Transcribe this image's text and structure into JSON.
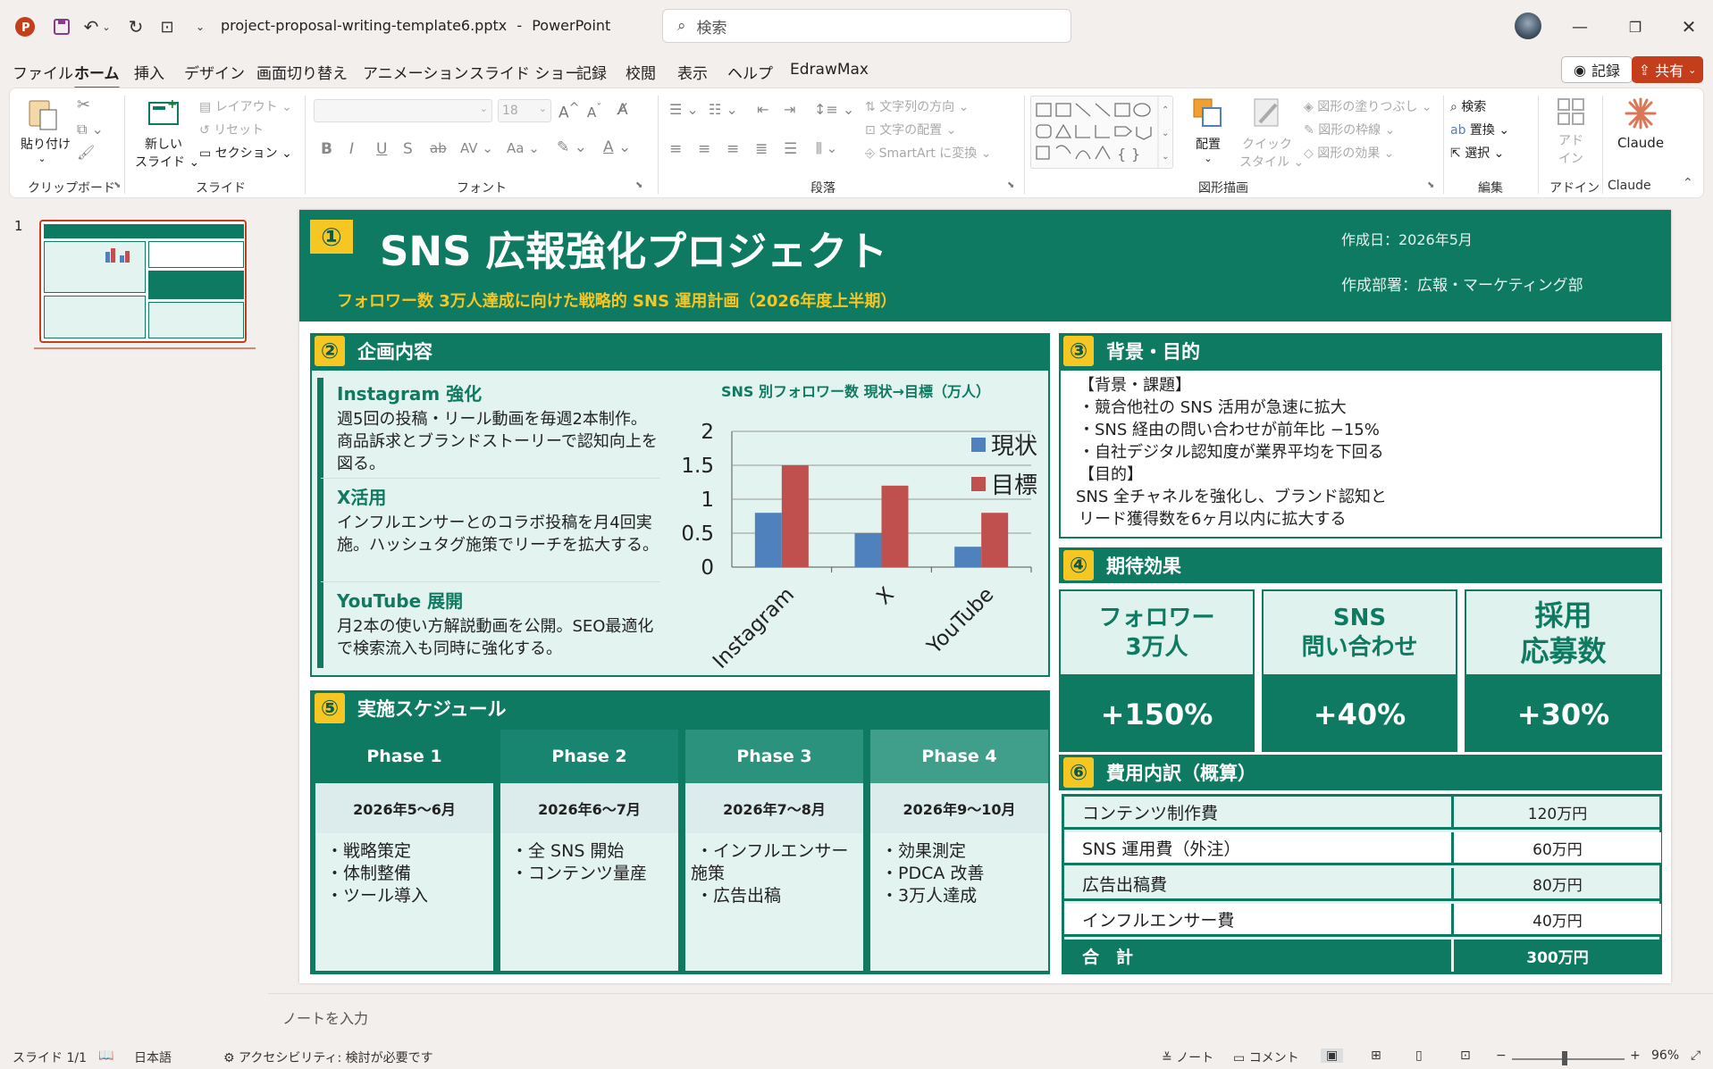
{
  "window": {
    "filename": "project-proposal-writing-template6.pptx",
    "separator": "-",
    "app": "PowerPoint",
    "search_placeholder": "検索"
  },
  "menu": {
    "items": [
      "ファイル",
      "ホーム",
      "挿入",
      "デザイン",
      "画面切り替え",
      "アニメーション",
      "スライド ショー",
      "記録",
      "校閲",
      "表示",
      "ヘルプ",
      "EdrawMax"
    ],
    "active": "ホーム",
    "record_button": "記録",
    "share_button": "共有"
  },
  "ribbon": {
    "groups": {
      "clipboard": "クリップボード",
      "slides": "スライド",
      "font": "フォント",
      "paragraph": "段落",
      "drawing": "図形描画",
      "editing": "編集",
      "addin": "アドイン",
      "claude": "Claude"
    },
    "paste": "貼り付け",
    "new_slide_1": "新しい",
    "new_slide_2": "スライド",
    "layout": "レイアウト",
    "reset": "リセット",
    "section": "セクション",
    "font_size": "18",
    "text_direction": "文字列の方向",
    "text_align": "文字の配置",
    "smartart": "SmartArt に変換",
    "arrange": "配置",
    "quick_style_1": "クイック",
    "quick_style_2": "スタイル",
    "shape_fill": "図形の塗りつぶし",
    "shape_outline": "図形の枠線",
    "shape_effect": "図形の効果",
    "find": "検索",
    "replace": "置換",
    "select": "選択",
    "addin_1": "アド",
    "addin_2": "イン",
    "claude": "Claude"
  },
  "thumbnail": {
    "number": "1"
  },
  "notes_placeholder": "ノートを入力",
  "status": {
    "slide": "スライド 1/1",
    "language": "日本語",
    "accessibility": "アクセシビリティ: 検討が必要です",
    "notes": "ノート",
    "comments": "コメント",
    "zoom": "96%"
  },
  "slide": {
    "header": {
      "num": "①",
      "title": "SNS 広報強化プロジェクト",
      "subtitle": "フォロワー数 3万人達成に向けた戦略的 SNS 運用計画（2026年度上半期）",
      "date": "作成日：2026年5月",
      "dept": "作成部署：広報・マーケティング部"
    },
    "plan": {
      "num": "②",
      "title": "企画内容",
      "items": [
        {
          "title": "Instagram 強化",
          "body": "週5回の投稿・リール動画を毎週2本制作。商品訴求とブランドストーリーで認知向上を図る。"
        },
        {
          "title": "X活用",
          "body": "インフルエンサーとのコラボ投稿を月4回実施。ハッシュタグ施策でリーチを拡大する。"
        },
        {
          "title": "YouTube 展開",
          "body": "月2本の使い方解説動画を公開。SEO最適化で検索流入も同時に強化する。"
        }
      ]
    },
    "background": {
      "num": "③",
      "title": "背景・目的",
      "lines": [
        "【背景・課題】",
        "・競合他社の SNS 活用が急速に拡大",
        "・SNS 経由の問い合わせが前年比 −15%",
        "・自社デジタル認知度が業界平均を下回る",
        "【目的】",
        "SNS 全チャネルを強化し、ブランド認知と",
        "リード獲得数を6ヶ月以内に拡大する"
      ]
    },
    "effect": {
      "num": "④",
      "title": "期待効果",
      "cards": [
        {
          "label1": "フォロワー",
          "label2": "3万人",
          "value": "+150%"
        },
        {
          "label1": "SNS",
          "label2": "問い合わせ",
          "value": "+40%"
        },
        {
          "label1": "採用",
          "label2": "応募数",
          "value": "+30%"
        }
      ]
    },
    "schedule": {
      "num": "⑤",
      "title": "実施スケジュール",
      "phases": [
        {
          "name": "Phase 1",
          "period": "2026年5〜6月",
          "tasks": [
            "・戦略策定",
            "・体制整備",
            "・ツール導入"
          ],
          "color": "#0e7a62"
        },
        {
          "name": "Phase 2",
          "period": "2026年6〜7月",
          "tasks": [
            "・全 SNS 開始",
            "・コンテンツ量産"
          ],
          "color": "#178570"
        },
        {
          "name": "Phase 3",
          "period": "2026年7〜8月",
          "tasks": [
            "・インフルエンサー",
            "施策",
            "・広告出稿"
          ],
          "color": "#2b937d"
        },
        {
          "name": "Phase 4",
          "period": "2026年9〜10月",
          "tasks": [
            "・効果測定",
            "・PDCA 改善",
            "・3万人達成"
          ],
          "color": "#3f9f8b"
        }
      ]
    },
    "cost": {
      "num": "⑥",
      "title": "費用内訳（概算）",
      "rows": [
        {
          "name": "コンテンツ制作費",
          "value": "120万円"
        },
        {
          "name": "SNS 運用費（外注）",
          "value": "60万円"
        },
        {
          "name": "広告出稿費",
          "value": "80万円"
        },
        {
          "name": "インフルエンサー費",
          "value": "40万円"
        }
      ],
      "total_name": "合　計",
      "total_value": "300万円"
    }
  },
  "chart_data": {
    "type": "bar",
    "title": "SNS 別フォロワー数 現状→目標（万人）",
    "categories": [
      "Instagram",
      "X",
      "YouTube"
    ],
    "series": [
      {
        "name": "現状",
        "values": [
          0.8,
          0.5,
          0.3
        ],
        "color": "#4f81bd"
      },
      {
        "name": "目標",
        "values": [
          1.5,
          1.2,
          0.8
        ],
        "color": "#c0504d"
      }
    ],
    "ylim": [
      0,
      2
    ],
    "yticks": [
      "0",
      "0.5",
      "1",
      "1.5",
      "2"
    ],
    "legend": "top-right"
  }
}
